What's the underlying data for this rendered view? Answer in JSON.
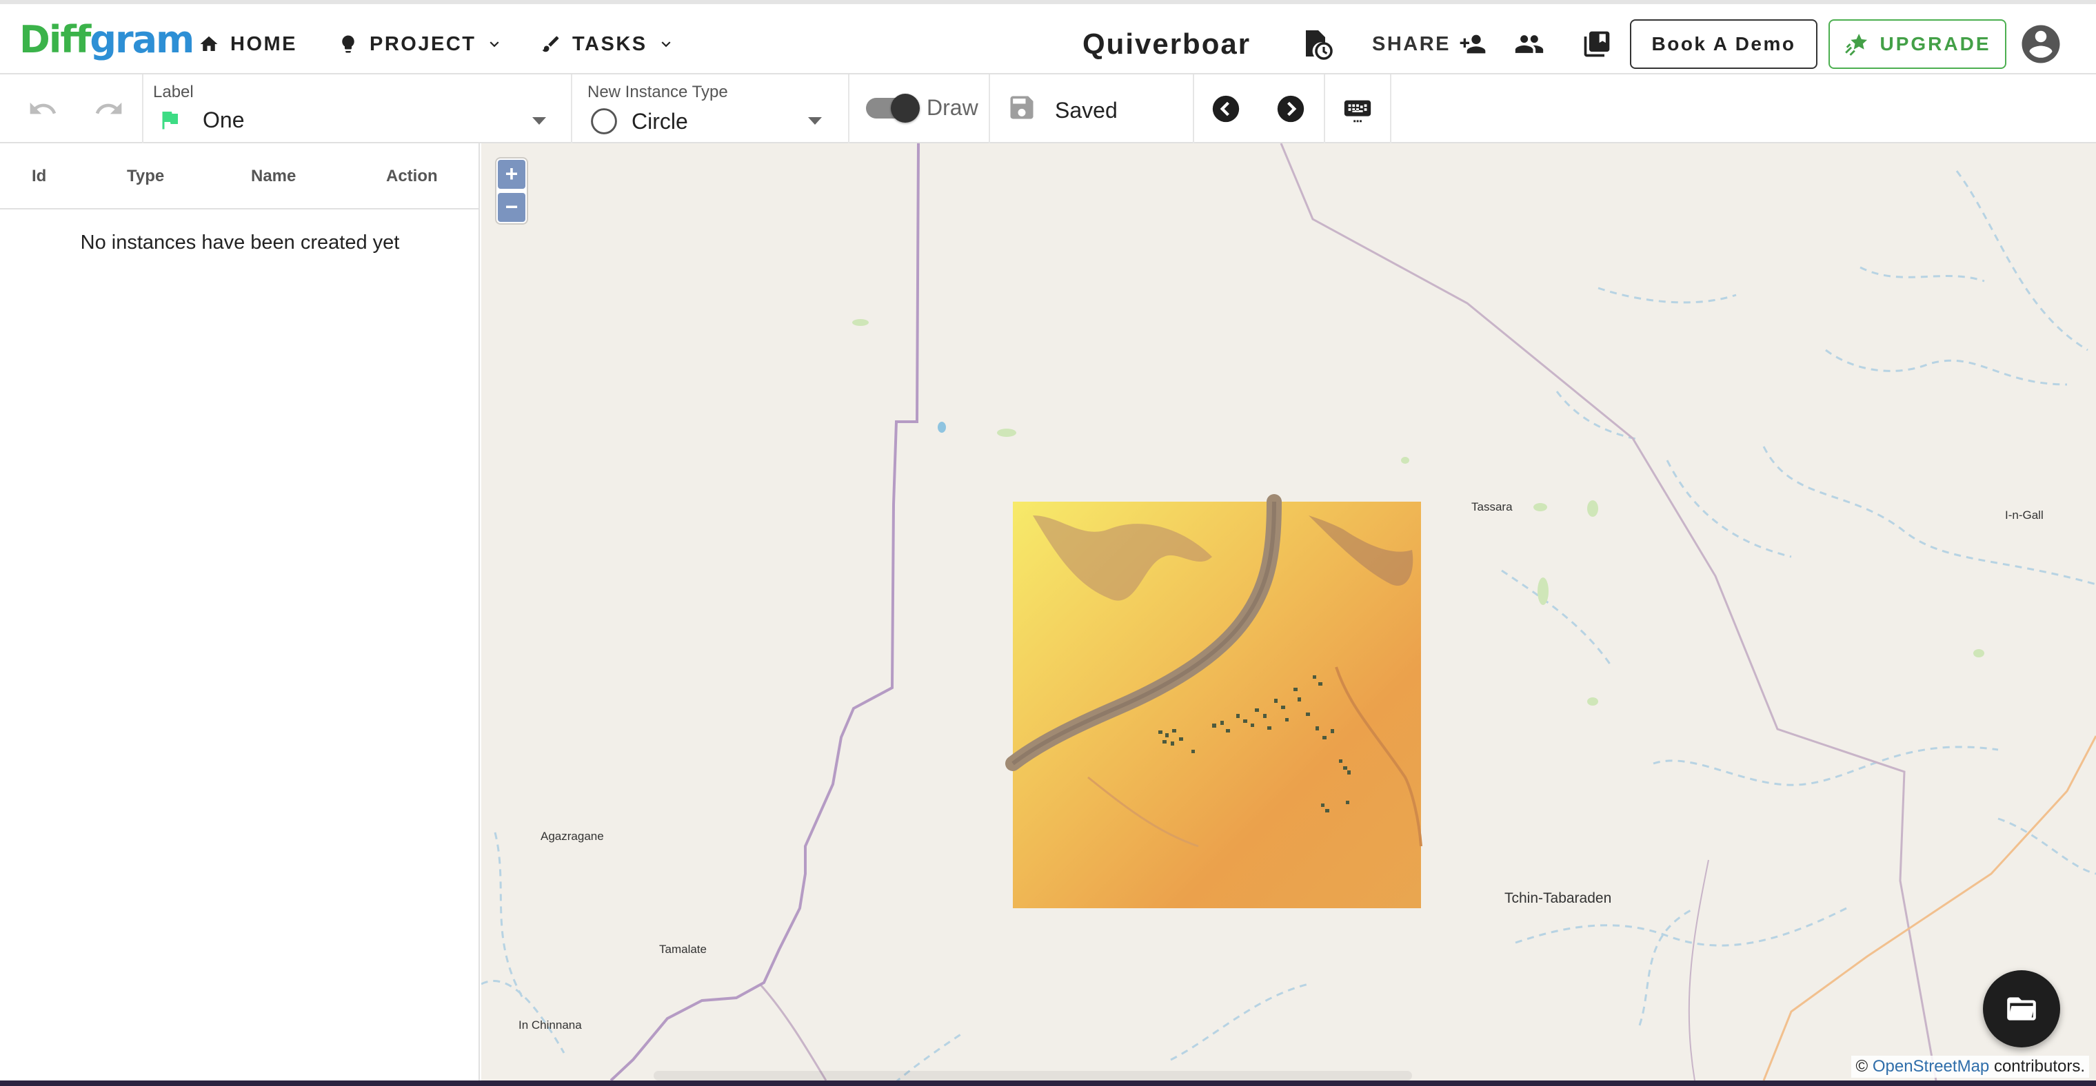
{
  "logo": {
    "part1": "Diff",
    "part2": "gram"
  },
  "nav": {
    "home_label": "HOME",
    "project_label": "PROJECT",
    "tasks_label": "TASKS",
    "project_title": "Quiverboar",
    "share_label": "SHARE",
    "demo_label": "Book A Demo",
    "upgrade_label": "UPGRADE"
  },
  "toolbar": {
    "label_caption": "Label",
    "label_value": "One",
    "label_color": "#3ddc84",
    "instance_type_caption": "New Instance Type",
    "instance_type_value": "Circle",
    "draw_label": "Draw",
    "draw_enabled": true,
    "saved_label": "Saved"
  },
  "instances": {
    "columns": [
      "Id",
      "Type",
      "Name",
      "Action"
    ],
    "empty_message": "No instances have been created yet"
  },
  "map": {
    "zoom_in": "+",
    "zoom_out": "−",
    "places": [
      "Tassara",
      "I-n-Gall",
      "Agazragane",
      "Tamalate",
      "In Chinnana",
      "Tchin-Tabaraden"
    ],
    "attribution_prefix": "©",
    "attribution_link": "OpenStreetMap",
    "attribution_suffix": "contributors."
  },
  "icons": {
    "home": "home-icon",
    "project": "lightbulb-icon",
    "tasks": "brush-icon",
    "history": "file-clock-icon",
    "share": "add-people-icon",
    "members": "people-icon",
    "docs": "book-icon",
    "upgrade": "star-icon",
    "avatar": "account-circle-icon",
    "folder": "folder-open-icon"
  }
}
